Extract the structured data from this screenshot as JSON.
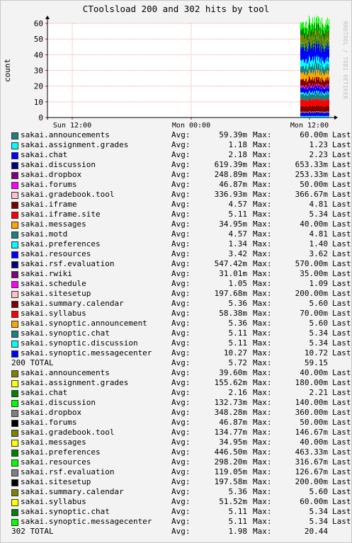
{
  "chart_data": {
    "type": "area",
    "title": "CToolsload 200 and 302 hits by tool",
    "ylabel": "count",
    "watermark": "RRDTOOL / TOBI OETIKER",
    "ylim": [
      0,
      60
    ],
    "y_ticks": [
      0,
      10,
      20,
      30,
      40,
      50,
      60
    ],
    "x_ticks": [
      "Sun 12:00",
      "Mon 00:00",
      "Mon 12:00"
    ],
    "grid": true,
    "stacked_totals_estimate": [
      {
        "series": "200",
        "approx_range": [
          20,
          59
        ]
      },
      {
        "series": "302",
        "approx_range": [
          0,
          20
        ]
      }
    ]
  },
  "legend_labels": {
    "avg": "Avg:",
    "max": "Max:",
    "last": "Last"
  },
  "legend": [
    {
      "name": "sakai.announcements",
      "color": "#1a8080",
      "avg": "59.39m",
      "max": "60.00m"
    },
    {
      "name": "sakai.assignment.grades",
      "color": "#00ffff",
      "avg": "1.18",
      "max": "1.23"
    },
    {
      "name": "sakai.chat",
      "color": "#0000ff",
      "avg": "2.18",
      "max": "2.23"
    },
    {
      "name": "sakai.discussion",
      "color": "#000080",
      "avg": "619.39m",
      "max": "653.33m"
    },
    {
      "name": "sakai.dropbox",
      "color": "#800080",
      "avg": "248.89m",
      "max": "253.33m"
    },
    {
      "name": "sakai.forums",
      "color": "#ff00ff",
      "avg": "46.87m",
      "max": "50.00m"
    },
    {
      "name": "sakai.gradebook.tool",
      "color": "#ffc0cb",
      "avg": "336.93m",
      "max": "366.67m"
    },
    {
      "name": "sakai.iframe",
      "color": "#800000",
      "avg": "4.57",
      "max": "4.81"
    },
    {
      "name": "sakai.iframe.site",
      "color": "#ff0000",
      "avg": "5.11",
      "max": "5.34"
    },
    {
      "name": "sakai.messages",
      "color": "#ffa500",
      "avg": "34.95m",
      "max": "40.00m"
    },
    {
      "name": "sakai.motd",
      "color": "#1a8080",
      "avg": "4.57",
      "max": "4.81"
    },
    {
      "name": "sakai.preferences",
      "color": "#00ffff",
      "avg": "1.34",
      "max": "1.40"
    },
    {
      "name": "sakai.resources",
      "color": "#0000ff",
      "avg": "3.42",
      "max": "3.62"
    },
    {
      "name": "sakai.rsf.evaluation",
      "color": "#000080",
      "avg": "547.42m",
      "max": "570.00m"
    },
    {
      "name": "sakai.rwiki",
      "color": "#800080",
      "avg": "31.01m",
      "max": "35.00m"
    },
    {
      "name": "sakai.schedule",
      "color": "#ff00ff",
      "avg": "1.05",
      "max": "1.09"
    },
    {
      "name": "sakai.sitesetup",
      "color": "#ffc0cb",
      "avg": "197.68m",
      "max": "200.00m"
    },
    {
      "name": "sakai.summary.calendar",
      "color": "#800000",
      "avg": "5.36",
      "max": "5.60"
    },
    {
      "name": "sakai.syllabus",
      "color": "#ff0000",
      "avg": "58.38m",
      "max": "70.00m"
    },
    {
      "name": "sakai.synoptic.announcement",
      "color": "#ffa500",
      "avg": "5.36",
      "max": "5.60"
    },
    {
      "name": "sakai.synoptic.chat",
      "color": "#1a8080",
      "avg": "5.11",
      "max": "5.34"
    },
    {
      "name": "sakai.synoptic.discussion",
      "color": "#00ffff",
      "avg": "5.11",
      "max": "5.34"
    },
    {
      "name": "sakai.synoptic.messagecenter",
      "color": "#0000ff",
      "avg": "10.27",
      "max": "10.72"
    },
    {
      "total": true,
      "name": "200 TOTAL",
      "avg": "5.72",
      "max": "59.15"
    },
    {
      "name": "sakai.announcements",
      "color": "#808000",
      "avg": "39.60m",
      "max": "40.00m"
    },
    {
      "name": "sakai.assignment.grades",
      "color": "#ffff00",
      "avg": "155.62m",
      "max": "180.00m"
    },
    {
      "name": "sakai.chat",
      "color": "#008000",
      "avg": "2.16",
      "max": "2.21"
    },
    {
      "name": "sakai.discussion",
      "color": "#00ff00",
      "avg": "132.73m",
      "max": "140.00m"
    },
    {
      "name": "sakai.dropbox",
      "color": "#808080",
      "avg": "348.28m",
      "max": "360.00m"
    },
    {
      "name": "sakai.forums",
      "color": "#000000",
      "avg": "46.87m",
      "max": "50.00m"
    },
    {
      "name": "sakai.gradebook.tool",
      "color": "#808000",
      "avg": "134.77m",
      "max": "146.67m"
    },
    {
      "name": "sakai.messages",
      "color": "#ffff00",
      "avg": "34.95m",
      "max": "40.00m"
    },
    {
      "name": "sakai.preferences",
      "color": "#008000",
      "avg": "446.50m",
      "max": "463.33m"
    },
    {
      "name": "sakai.resources",
      "color": "#00ff00",
      "avg": "298.20m",
      "max": "316.67m"
    },
    {
      "name": "sakai.rsf.evaluation",
      "color": "#808080",
      "avg": "119.05m",
      "max": "126.67m"
    },
    {
      "name": "sakai.sitesetup",
      "color": "#000000",
      "avg": "197.58m",
      "max": "200.00m"
    },
    {
      "name": "sakai.summary.calendar",
      "color": "#808000",
      "avg": "5.36",
      "max": "5.60"
    },
    {
      "name": "sakai.syllabus",
      "color": "#ffff00",
      "avg": "51.52m",
      "max": "60.00m"
    },
    {
      "name": "sakai.synoptic.chat",
      "color": "#008000",
      "avg": "5.11",
      "max": "5.34"
    },
    {
      "name": "sakai.synoptic.messagecenter",
      "color": "#00ff00",
      "avg": "5.11",
      "max": "5.34"
    },
    {
      "total": true,
      "name": "302 TOTAL",
      "avg": "1.98",
      "max": "20.44"
    }
  ]
}
